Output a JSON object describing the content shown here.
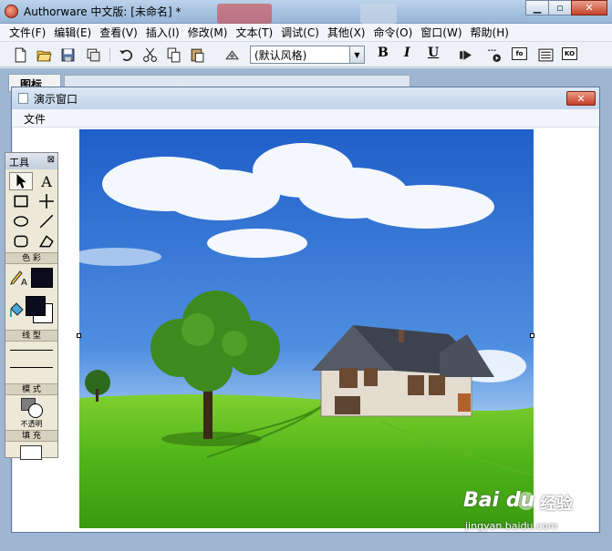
{
  "window": {
    "title": "Authorware 中文版: [未命名] *"
  },
  "menubar": {
    "items": [
      "文件(F)",
      "编辑(E)",
      "查看(V)",
      "插入(I)",
      "修改(M)",
      "文本(T)",
      "调试(C)",
      "其他(X)",
      "命令(O)",
      "窗口(W)",
      "帮助(H)"
    ]
  },
  "toolbar": {
    "style_value": "(默认风格)",
    "bold": "B",
    "italic": "I",
    "underline": "U",
    "fo": "fo",
    "ko": "KO"
  },
  "icon_panel": {
    "label": "图标"
  },
  "presentation": {
    "title": "演示窗口",
    "menu_file": "文件"
  },
  "tools": {
    "title": "工具",
    "close": "⊠",
    "text_tool": "A",
    "section_color": "色 彩",
    "section_line": "线 型",
    "section_mode": "模 式",
    "mode_value": "不透明",
    "section_fill": "填 充"
  },
  "watermark": {
    "brand": "Bai du",
    "cn": "经验",
    "url": "jingyan.baidu.com"
  }
}
